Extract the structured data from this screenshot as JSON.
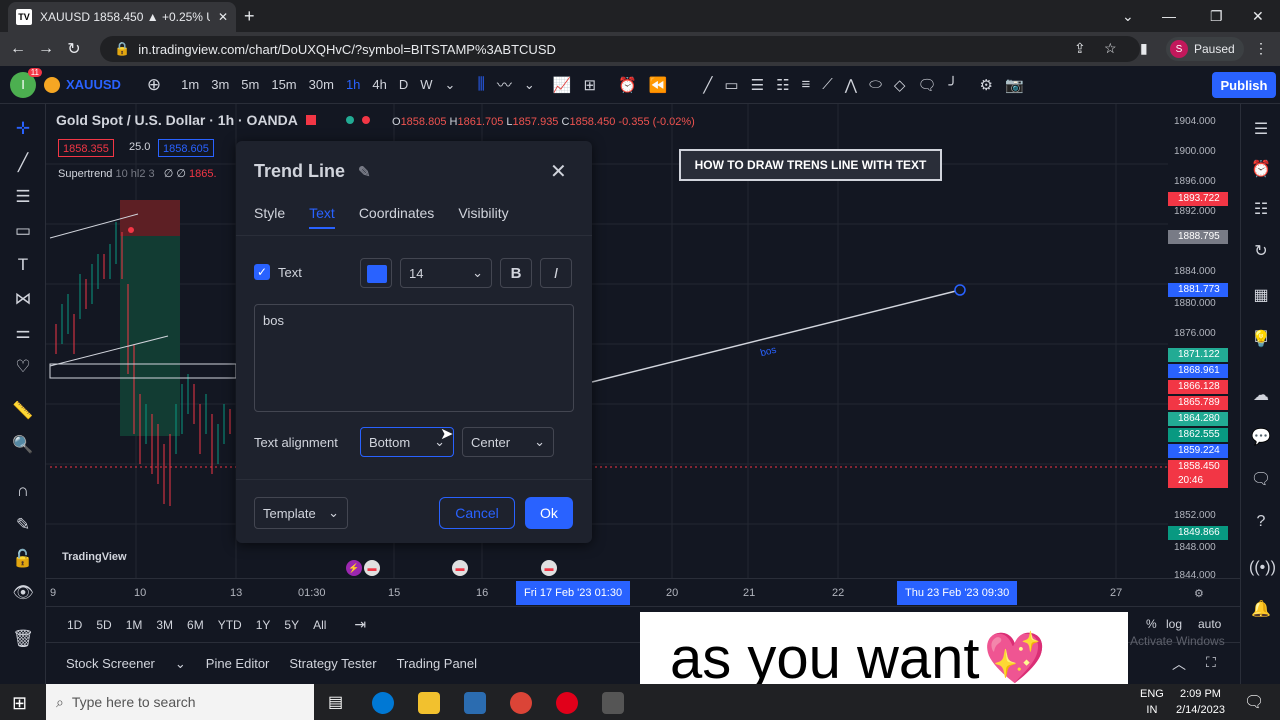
{
  "browser": {
    "tab_title": "XAUUSD 1858.450 ▲ +0.25% Un",
    "tab_favicon": "TV",
    "url": "in.tradingview.com/chart/DoUXQHvC/?symbol=BITSTAMP%3ABTCUSD",
    "profile_initial": "S",
    "profile_status": "Paused"
  },
  "toolbar": {
    "badge_count": "11",
    "symbol": "XAUUSD",
    "intervals": [
      "1m",
      "3m",
      "5m",
      "15m",
      "30m",
      "1h",
      "4h",
      "D",
      "W"
    ],
    "active_interval": "1h",
    "publish_label": "Publish"
  },
  "legend": {
    "title": "Gold Spot / U.S. Dollar · 1h · OANDA",
    "o_label": "O",
    "o": "1858.805",
    "h_label": "H",
    "h": "1861.705",
    "l_label": "L",
    "l": "1857.935",
    "c_label": "C",
    "c": "1858.450",
    "change": "-0.355 (-0.02%)",
    "bid": "1858.355",
    "spread": "25.0",
    "ask": "1858.605",
    "indicator_name": "Supertrend",
    "indicator_params": "10 hl2 3",
    "indicator_values": "∅ ∅",
    "indicator_value": "1865."
  },
  "dialog": {
    "title": "Trend Line",
    "tabs": [
      "Style",
      "Text",
      "Coordinates",
      "Visibility"
    ],
    "active_tab": "Text",
    "text_label": "Text",
    "text_checked": true,
    "text_color": "#2962ff",
    "font_size": "14",
    "bold_label": "B",
    "italic_label": "I",
    "text_value": "bos",
    "alignment_label": "Text alignment",
    "vertical_align": "Bottom",
    "horizontal_align": "Center",
    "template_label": "Template",
    "cancel_label": "Cancel",
    "ok_label": "Ok"
  },
  "chart": {
    "annotation_box": "HOW TO DRAW TRENS LINE WITH TEXT",
    "line_text": "bos",
    "watermark": "TradingView",
    "price_labels": [
      "1904.000",
      "1900.000",
      "1896.000",
      "1892.000",
      "1884.000",
      "1880.000",
      "1876.000",
      "1852.000",
      "1848.000",
      "1844.000"
    ],
    "price_tags": [
      {
        "value": "1893.722",
        "color": "#f23645"
      },
      {
        "value": "1888.795",
        "color": "#787b86"
      },
      {
        "value": "1881.773",
        "color": "#2962ff"
      },
      {
        "value": "1871.122",
        "color": "#22ab94"
      },
      {
        "value": "1868.961",
        "color": "#2962ff"
      },
      {
        "value": "1866.128",
        "color": "#f23645"
      },
      {
        "value": "1865.789",
        "color": "#f23645"
      },
      {
        "value": "1864.280",
        "color": "#22ab94"
      },
      {
        "value": "1862.555",
        "color": "#089981"
      },
      {
        "value": "1859.224",
        "color": "#2962ff"
      },
      {
        "value": "1858.450",
        "color": "#f23645"
      },
      {
        "value": "20:46",
        "color": "#f23645"
      },
      {
        "value": "1849.866",
        "color": "#089981"
      }
    ],
    "time_labels": [
      "9",
      "10",
      "13",
      "01:30",
      "15",
      "16",
      "20",
      "21",
      "22",
      "27"
    ],
    "time_selected_start": "Fri 17 Feb '23  01:30",
    "time_selected_end": "Thu 23 Feb '23  09:30"
  },
  "timeframes": [
    "1D",
    "5D",
    "1M",
    "3M",
    "6M",
    "YTD",
    "1Y",
    "5Y",
    "All"
  ],
  "scale_options": [
    "%",
    "log",
    "auto"
  ],
  "bottom_tabs": [
    "Stock Screener",
    "Pine Editor",
    "Strategy Tester",
    "Trading Panel"
  ],
  "caption": "as you want",
  "caption_emoji": "💖",
  "watermark_activate": "Activate Windows",
  "taskbar": {
    "search_placeholder": "Type here to search",
    "lang": "ENG",
    "region": "IN",
    "time": "2:09 PM",
    "date": "2/14/2023"
  }
}
